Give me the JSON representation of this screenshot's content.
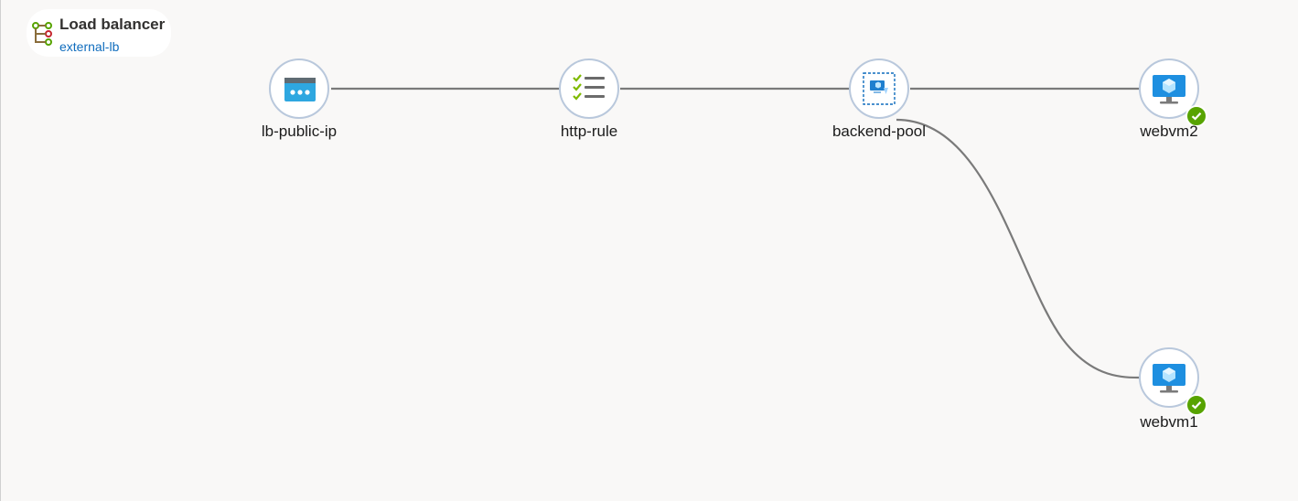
{
  "header": {
    "title": "Load balancer",
    "subtitle": "external-lb"
  },
  "nodes": {
    "lb_public_ip": {
      "label": "lb-public-ip",
      "icon": "public-ip-icon"
    },
    "http_rule": {
      "label": "http-rule",
      "icon": "rule-checklist-icon"
    },
    "backend_pool": {
      "label": "backend-pool",
      "icon": "backend-pool-icon"
    },
    "webvm2": {
      "label": "webvm2",
      "icon": "virtual-machine-icon",
      "status": "healthy"
    },
    "webvm1": {
      "label": "webvm1",
      "icon": "virtual-machine-icon",
      "status": "healthy"
    }
  },
  "colors": {
    "background": "#f9f8f7",
    "edge": "#7a7a7a",
    "node_border": "#b9c8dc",
    "link": "#0f6cbd",
    "healthy": "#57a300"
  }
}
